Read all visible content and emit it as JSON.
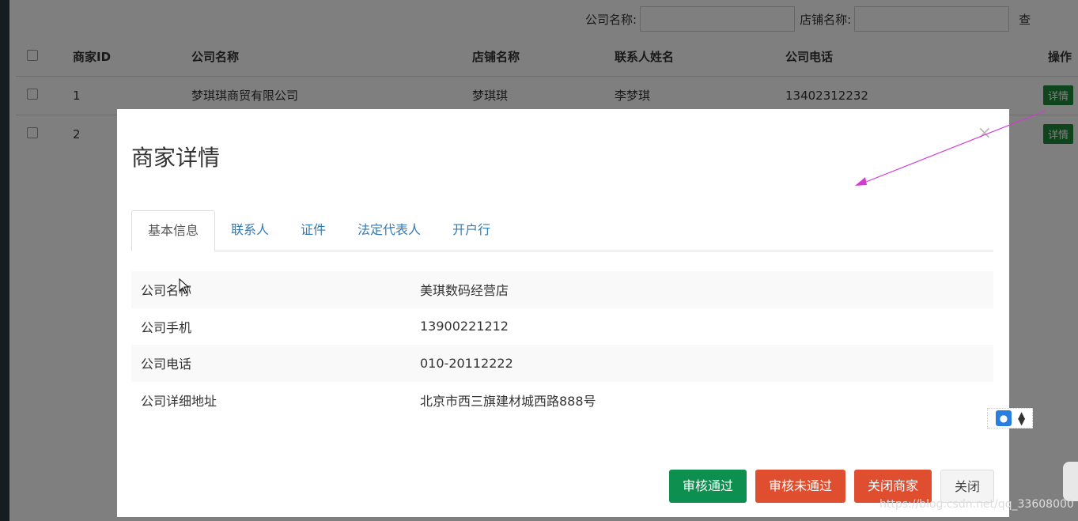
{
  "search": {
    "company_label": "公司名称:",
    "shop_label": "店铺名称:",
    "query_label": "查"
  },
  "table": {
    "headers": [
      "商家ID",
      "公司名称",
      "店铺名称",
      "联系人姓名",
      "公司电话",
      "操作"
    ],
    "rows": [
      {
        "id": "1",
        "company": "梦琪琪商贸有限公司",
        "shop": "梦琪琪",
        "contact": "李梦琪",
        "phone": "13402312232",
        "action": "详情"
      },
      {
        "id": "2",
        "action": "详情"
      }
    ]
  },
  "modal": {
    "title": "商家详情",
    "close": "×",
    "tabs": [
      "基本信息",
      "联系人",
      "证件",
      "法定代表人",
      "开户行"
    ],
    "info": [
      {
        "key": "公司名称",
        "value": "美琪数码经营店"
      },
      {
        "key": "公司手机",
        "value": "13900221212"
      },
      {
        "key": "公司电话",
        "value": "010-20112222"
      },
      {
        "key": "公司详细地址",
        "value": "北京市西三旗建材城西路888号"
      }
    ],
    "buttons": {
      "approve": "审核通过",
      "reject": "审核未通过",
      "close_shop": "关闭商家",
      "close": "关闭"
    }
  },
  "watermark": "https://blog.csdn.net/qq_33608000",
  "colors": {
    "approve": "#0c8f4f",
    "reject": "#e04e30",
    "tab_link": "#337ab7",
    "arrow": "#d23ad6"
  },
  "icons": [
    "contact-card-icon",
    "sort-updown-icon",
    "close-icon",
    "mouse-cursor-icon"
  ]
}
